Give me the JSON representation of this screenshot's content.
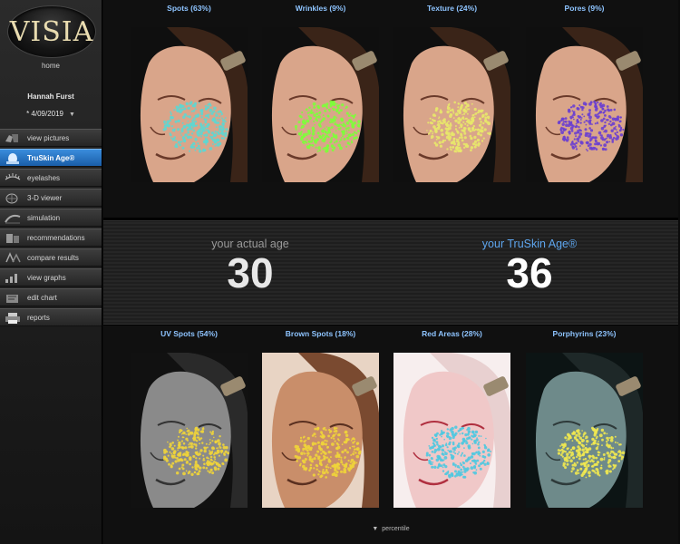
{
  "app": {
    "logo_text": "VISIA",
    "home_label": "home"
  },
  "patient": {
    "name": "Hannah Furst",
    "date": "* 4/09/2019"
  },
  "nav": [
    {
      "id": "view-pictures",
      "label": "view pictures",
      "icon": "camera-icon",
      "active": false
    },
    {
      "id": "truskin-age",
      "label": "TruSkin Age®",
      "icon": "truskin-face-icon",
      "active": true
    },
    {
      "id": "eyelashes",
      "label": "eyelashes",
      "icon": "eyelash-icon",
      "active": false
    },
    {
      "id": "3d-viewer",
      "label": "3-D viewer",
      "icon": "3d-face-icon",
      "active": false
    },
    {
      "id": "simulation",
      "label": "simulation",
      "icon": "simulation-icon",
      "active": false
    },
    {
      "id": "recommendations",
      "label": "recommendations",
      "icon": "recommendations-icon",
      "active": false
    },
    {
      "id": "compare-results",
      "label": "compare results",
      "icon": "compare-icon",
      "active": false
    },
    {
      "id": "view-graphs",
      "label": "view graphs",
      "icon": "graph-icon",
      "active": false
    },
    {
      "id": "edit-chart",
      "label": "edit chart",
      "icon": "edit-chart-icon",
      "active": false
    },
    {
      "id": "reports",
      "label": "reports",
      "icon": "printer-icon",
      "active": false
    }
  ],
  "top_analyses": [
    {
      "label": "Spots (63%)",
      "type": "normal",
      "overlay": "#5fd6d0"
    },
    {
      "label": "Wrinkles (9%)",
      "type": "normal",
      "overlay": "#7dff3a"
    },
    {
      "label": "Texture (24%)",
      "type": "normal",
      "overlay": "#e8e86a"
    },
    {
      "label": "Pores (9%)",
      "type": "normal",
      "overlay": "#6a3fd0"
    }
  ],
  "bottom_analyses": [
    {
      "label": "UV Spots (54%)",
      "type": "uv",
      "overlay": "#f0d43a"
    },
    {
      "label": "Brown Spots (18%)",
      "type": "brown",
      "overlay": "#f0d43a"
    },
    {
      "label": "Red Areas (28%)",
      "type": "red",
      "overlay": "#4fc8e0"
    },
    {
      "label": "Porphyrins (23%)",
      "type": "porph",
      "overlay": "#f0e850"
    }
  ],
  "age": {
    "actual_label": "your actual age",
    "actual_value": "30",
    "truskin_label": "your TruSkin Age®",
    "truskin_value": "36"
  },
  "footer": {
    "percentile_label": "percentile"
  },
  "colors": {
    "accent_blue": "#1f6fc7",
    "caption_blue": "#8ec4ff",
    "truskin_label": "#5ea6ef"
  }
}
